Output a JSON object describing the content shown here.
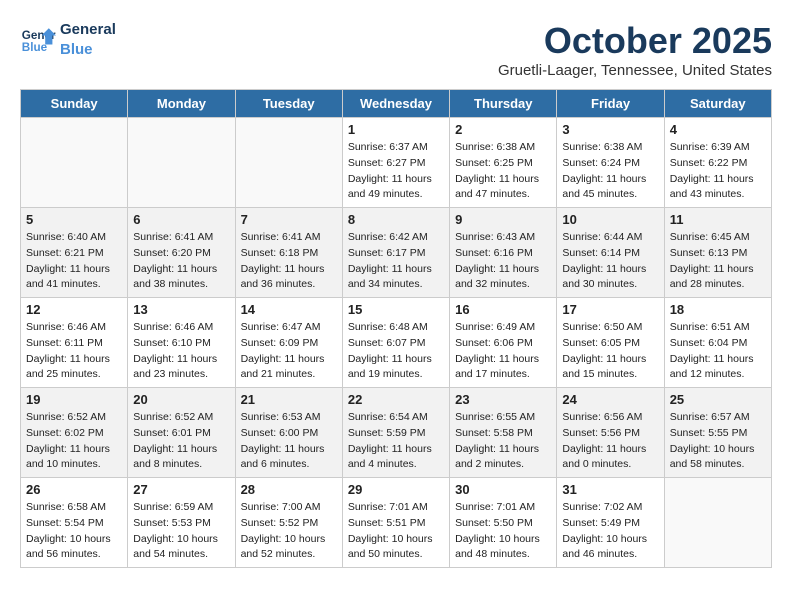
{
  "header": {
    "logo_line1": "General",
    "logo_line2": "Blue",
    "month": "October 2025",
    "location": "Gruetli-Laager, Tennessee, United States"
  },
  "days_of_week": [
    "Sunday",
    "Monday",
    "Tuesday",
    "Wednesday",
    "Thursday",
    "Friday",
    "Saturday"
  ],
  "weeks": [
    [
      {
        "day": "",
        "info": ""
      },
      {
        "day": "",
        "info": ""
      },
      {
        "day": "",
        "info": ""
      },
      {
        "day": "1",
        "info": "Sunrise: 6:37 AM\nSunset: 6:27 PM\nDaylight: 11 hours and 49 minutes."
      },
      {
        "day": "2",
        "info": "Sunrise: 6:38 AM\nSunset: 6:25 PM\nDaylight: 11 hours and 47 minutes."
      },
      {
        "day": "3",
        "info": "Sunrise: 6:38 AM\nSunset: 6:24 PM\nDaylight: 11 hours and 45 minutes."
      },
      {
        "day": "4",
        "info": "Sunrise: 6:39 AM\nSunset: 6:22 PM\nDaylight: 11 hours and 43 minutes."
      }
    ],
    [
      {
        "day": "5",
        "info": "Sunrise: 6:40 AM\nSunset: 6:21 PM\nDaylight: 11 hours and 41 minutes."
      },
      {
        "day": "6",
        "info": "Sunrise: 6:41 AM\nSunset: 6:20 PM\nDaylight: 11 hours and 38 minutes."
      },
      {
        "day": "7",
        "info": "Sunrise: 6:41 AM\nSunset: 6:18 PM\nDaylight: 11 hours and 36 minutes."
      },
      {
        "day": "8",
        "info": "Sunrise: 6:42 AM\nSunset: 6:17 PM\nDaylight: 11 hours and 34 minutes."
      },
      {
        "day": "9",
        "info": "Sunrise: 6:43 AM\nSunset: 6:16 PM\nDaylight: 11 hours and 32 minutes."
      },
      {
        "day": "10",
        "info": "Sunrise: 6:44 AM\nSunset: 6:14 PM\nDaylight: 11 hours and 30 minutes."
      },
      {
        "day": "11",
        "info": "Sunrise: 6:45 AM\nSunset: 6:13 PM\nDaylight: 11 hours and 28 minutes."
      }
    ],
    [
      {
        "day": "12",
        "info": "Sunrise: 6:46 AM\nSunset: 6:11 PM\nDaylight: 11 hours and 25 minutes."
      },
      {
        "day": "13",
        "info": "Sunrise: 6:46 AM\nSunset: 6:10 PM\nDaylight: 11 hours and 23 minutes."
      },
      {
        "day": "14",
        "info": "Sunrise: 6:47 AM\nSunset: 6:09 PM\nDaylight: 11 hours and 21 minutes."
      },
      {
        "day": "15",
        "info": "Sunrise: 6:48 AM\nSunset: 6:07 PM\nDaylight: 11 hours and 19 minutes."
      },
      {
        "day": "16",
        "info": "Sunrise: 6:49 AM\nSunset: 6:06 PM\nDaylight: 11 hours and 17 minutes."
      },
      {
        "day": "17",
        "info": "Sunrise: 6:50 AM\nSunset: 6:05 PM\nDaylight: 11 hours and 15 minutes."
      },
      {
        "day": "18",
        "info": "Sunrise: 6:51 AM\nSunset: 6:04 PM\nDaylight: 11 hours and 12 minutes."
      }
    ],
    [
      {
        "day": "19",
        "info": "Sunrise: 6:52 AM\nSunset: 6:02 PM\nDaylight: 11 hours and 10 minutes."
      },
      {
        "day": "20",
        "info": "Sunrise: 6:52 AM\nSunset: 6:01 PM\nDaylight: 11 hours and 8 minutes."
      },
      {
        "day": "21",
        "info": "Sunrise: 6:53 AM\nSunset: 6:00 PM\nDaylight: 11 hours and 6 minutes."
      },
      {
        "day": "22",
        "info": "Sunrise: 6:54 AM\nSunset: 5:59 PM\nDaylight: 11 hours and 4 minutes."
      },
      {
        "day": "23",
        "info": "Sunrise: 6:55 AM\nSunset: 5:58 PM\nDaylight: 11 hours and 2 minutes."
      },
      {
        "day": "24",
        "info": "Sunrise: 6:56 AM\nSunset: 5:56 PM\nDaylight: 11 hours and 0 minutes."
      },
      {
        "day": "25",
        "info": "Sunrise: 6:57 AM\nSunset: 5:55 PM\nDaylight: 10 hours and 58 minutes."
      }
    ],
    [
      {
        "day": "26",
        "info": "Sunrise: 6:58 AM\nSunset: 5:54 PM\nDaylight: 10 hours and 56 minutes."
      },
      {
        "day": "27",
        "info": "Sunrise: 6:59 AM\nSunset: 5:53 PM\nDaylight: 10 hours and 54 minutes."
      },
      {
        "day": "28",
        "info": "Sunrise: 7:00 AM\nSunset: 5:52 PM\nDaylight: 10 hours and 52 minutes."
      },
      {
        "day": "29",
        "info": "Sunrise: 7:01 AM\nSunset: 5:51 PM\nDaylight: 10 hours and 50 minutes."
      },
      {
        "day": "30",
        "info": "Sunrise: 7:01 AM\nSunset: 5:50 PM\nDaylight: 10 hours and 48 minutes."
      },
      {
        "day": "31",
        "info": "Sunrise: 7:02 AM\nSunset: 5:49 PM\nDaylight: 10 hours and 46 minutes."
      },
      {
        "day": "",
        "info": ""
      }
    ]
  ]
}
